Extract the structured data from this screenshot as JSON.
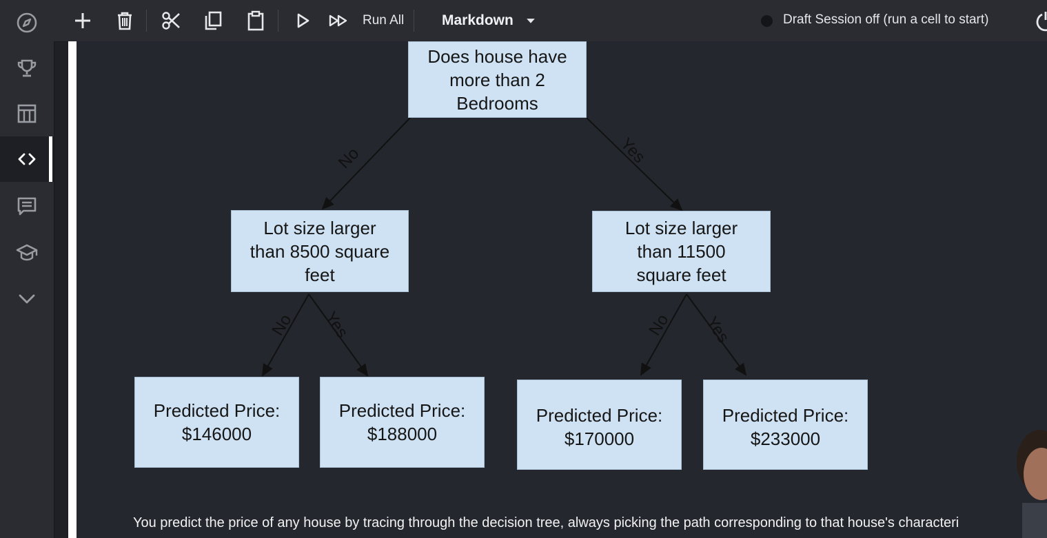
{
  "toolbar": {
    "run_all_label": "Run All",
    "cell_type": "Markdown",
    "session_status": "Draft Session off (run a cell to start)"
  },
  "sidebar": {
    "items": [
      {
        "icon": "compass-icon"
      },
      {
        "icon": "trophy-icon"
      },
      {
        "icon": "table-icon"
      },
      {
        "icon": "code-icon",
        "active": true
      },
      {
        "icon": "comment-icon"
      },
      {
        "icon": "graduation-cap-icon"
      },
      {
        "icon": "chevron-down-icon"
      }
    ]
  },
  "decision_tree": {
    "root": {
      "line1": "Does house have",
      "line2": "more than 2",
      "line3": "Bedrooms"
    },
    "left": {
      "line1": "Lot size larger",
      "line2": "than 8500 square",
      "line3": "feet",
      "edge_label": "No",
      "leaves": [
        {
          "edge_label": "No",
          "label": "Predicted Price:",
          "price": "$146000"
        },
        {
          "edge_label": "Yes",
          "label": "Predicted Price:",
          "price": "$188000"
        }
      ]
    },
    "right": {
      "line1": "Lot size larger",
      "line2": "than 11500",
      "line3": "square feet",
      "edge_label": "Yes",
      "leaves": [
        {
          "edge_label": "No",
          "label": "Predicted Price:",
          "price": "$170000"
        },
        {
          "edge_label": "Yes",
          "label": "Predicted Price:",
          "price": "$233000"
        }
      ]
    }
  },
  "caption": "You predict the price of any house by tracing through the decision tree, always picking the path corresponding to that house's characteri",
  "colors": {
    "node_fill": "#cfe2f3",
    "background": "#24272e",
    "toolbar": "#2a2c32"
  }
}
